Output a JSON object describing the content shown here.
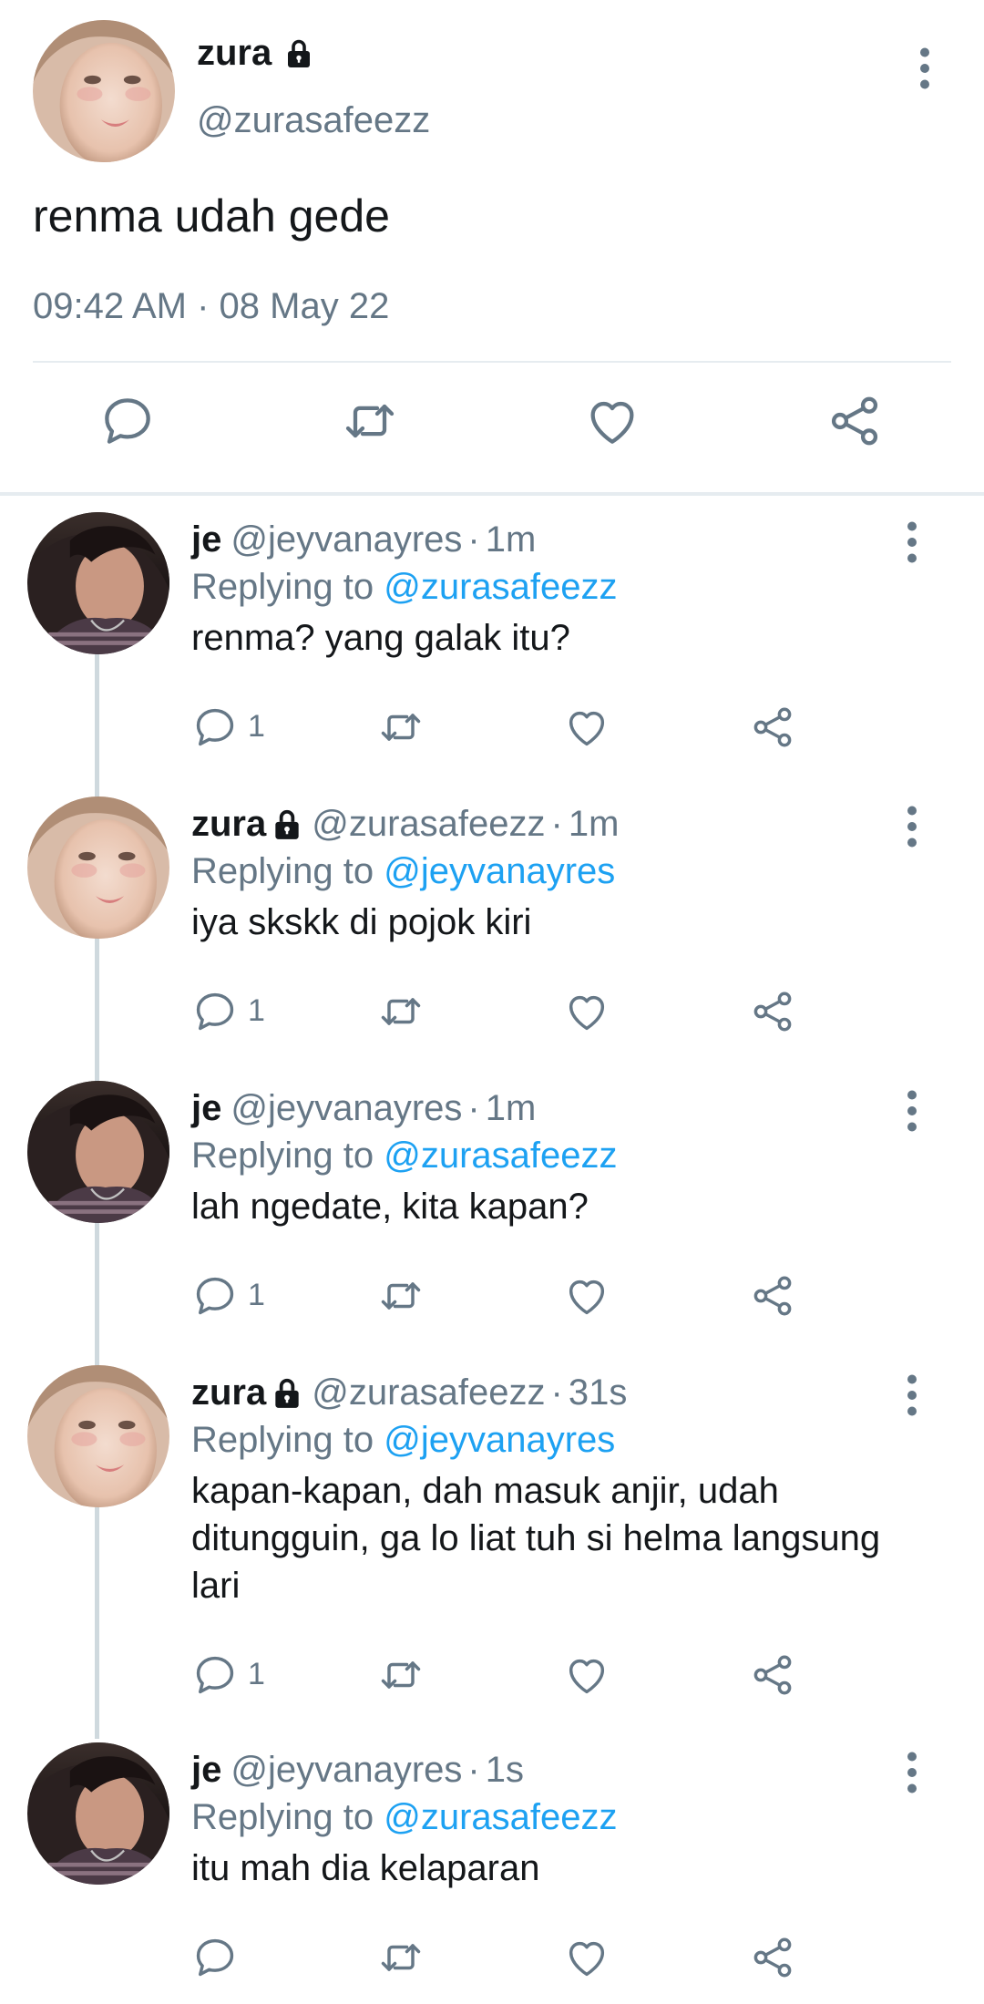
{
  "colors": {
    "accent": "#1da1f2",
    "muted": "#657786",
    "text": "#14171a",
    "divider": "#e6ecf0"
  },
  "main_tweet": {
    "name": "zura",
    "handle": "@zurasafeezz",
    "text": "renma udah gede",
    "timestamp": "09:42 AM · 08 May 22",
    "icons": [
      "reply-icon",
      "retweet-icon",
      "like-icon",
      "share-icon"
    ]
  },
  "replies": [
    {
      "name": "je",
      "locked": false,
      "handle": "@jeyvanayres",
      "time": "1m",
      "reply_prefix": "Replying to",
      "reply_to": "@zurasafeezz",
      "text": "renma? yang galak itu?",
      "reply_count": "1"
    },
    {
      "name": "zura",
      "locked": true,
      "handle": "@zurasafeezz",
      "time": "1m",
      "reply_prefix": "Replying to",
      "reply_to": "@jeyvanayres",
      "text": "iya skskk di pojok kiri",
      "reply_count": "1"
    },
    {
      "name": "je",
      "locked": false,
      "handle": "@jeyvanayres",
      "time": "1m",
      "reply_prefix": "Replying to",
      "reply_to": "@zurasafeezz",
      "text": "lah ngedate, kita kapan?",
      "reply_count": "1"
    },
    {
      "name": "zura",
      "locked": true,
      "handle": "@zurasafeezz",
      "time": "31s",
      "reply_prefix": "Replying to",
      "reply_to": "@jeyvanayres",
      "text": "kapan-kapan, dah masuk anjir, udah ditungguin, ga lo liat tuh si helma langsung lari",
      "reply_count": "1"
    },
    {
      "name": "je",
      "locked": false,
      "handle": "@jeyvanayres",
      "time": "1s",
      "reply_prefix": "Replying to",
      "reply_to": "@zurasafeezz",
      "text": "itu mah dia kelaparan",
      "reply_count": ""
    }
  ]
}
